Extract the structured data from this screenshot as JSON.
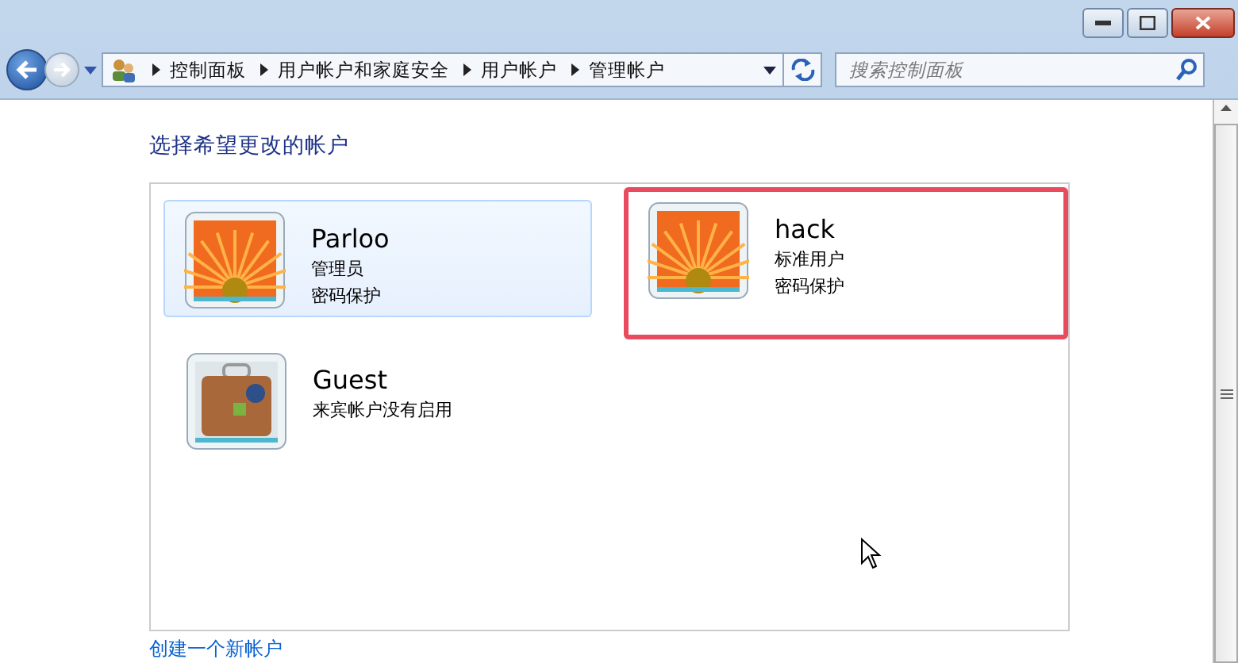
{
  "breadcrumb": [
    "控制面板",
    "用户帐户和家庭安全",
    "用户帐户",
    "管理帐户"
  ],
  "search": {
    "placeholder": "搜索控制面板"
  },
  "heading": "选择希望更改的帐户",
  "accounts": [
    {
      "name": "Parloo",
      "lines": [
        "管理员",
        "密码保护"
      ],
      "kind": "flower",
      "selected": true,
      "highlighted": false
    },
    {
      "name": "hack",
      "lines": [
        "标准用户",
        "密码保护"
      ],
      "kind": "flower",
      "selected": false,
      "highlighted": true
    },
    {
      "name": "Guest",
      "lines": [
        "来宾帐户没有启用"
      ],
      "kind": "suitcase",
      "selected": false,
      "highlighted": false
    }
  ],
  "create_link": "创建一个新帐户"
}
